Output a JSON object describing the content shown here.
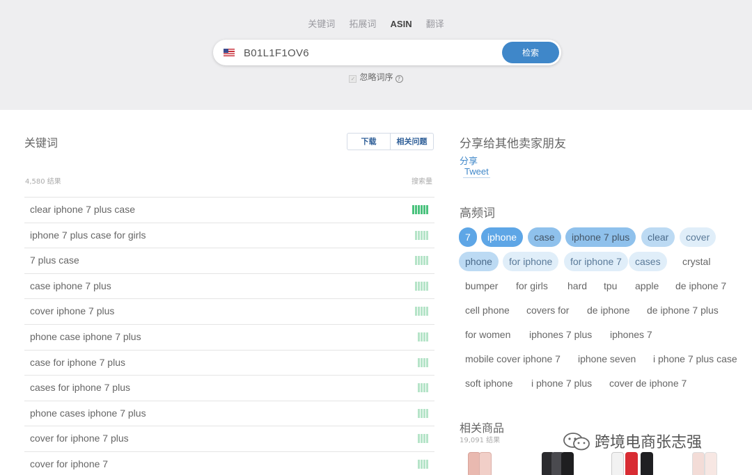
{
  "modes": [
    "关键词",
    "拓展词",
    "ASIN",
    "翻译"
  ],
  "active_mode_index": 2,
  "search": {
    "flag": "us-flag-icon",
    "value": "B01L1F1OV6",
    "button_label": "检索",
    "ignore_order_label": "忽略词序",
    "ignore_order_checked": true
  },
  "keywords_panel": {
    "title": "关键词",
    "download_label": "下载",
    "related_questions_label": "相关问题",
    "results_count": "4,580 结果",
    "volume_label": "搜索量",
    "rows": [
      {
        "keyword": "clear iphone 7 plus case",
        "bars": 6,
        "strong": true
      },
      {
        "keyword": "iphone 7 plus case for girls",
        "bars": 5,
        "strong": false
      },
      {
        "keyword": "7 plus case",
        "bars": 5,
        "strong": false
      },
      {
        "keyword": "case iphone 7 plus",
        "bars": 5,
        "strong": false
      },
      {
        "keyword": "cover iphone 7 plus",
        "bars": 5,
        "strong": false
      },
      {
        "keyword": "phone case iphone 7 plus",
        "bars": 4,
        "strong": false
      },
      {
        "keyword": "case for iphone 7 plus",
        "bars": 4,
        "strong": false
      },
      {
        "keyword": "cases for iphone 7 plus",
        "bars": 4,
        "strong": false
      },
      {
        "keyword": "phone cases iphone 7 plus",
        "bars": 4,
        "strong": false
      },
      {
        "keyword": "cover for iphone 7 plus",
        "bars": 4,
        "strong": false
      },
      {
        "keyword": "cover for iphone 7",
        "bars": 4,
        "strong": false
      }
    ]
  },
  "share": {
    "title": "分享给其他卖家朋友",
    "share_link": "分享",
    "tweet_label": "Tweet"
  },
  "high_frequency": {
    "title": "高频词",
    "tags": [
      {
        "text": "7",
        "level": 1
      },
      {
        "text": "iphone",
        "level": 1
      },
      {
        "text": "case",
        "level": 2
      },
      {
        "text": "iphone 7 plus",
        "level": 2
      },
      {
        "text": "clear",
        "level": 3
      },
      {
        "text": "cover",
        "level": 4
      },
      {
        "text": "phone",
        "level": 3
      },
      {
        "text": "for iphone",
        "level": 4
      },
      {
        "text": "for iphone 7",
        "level": 4
      },
      {
        "text": "cases",
        "level": 4
      },
      {
        "text": "crystal",
        "level": 5
      },
      {
        "text": "bumper",
        "level": 5
      },
      {
        "text": "for girls",
        "level": 5
      },
      {
        "text": "hard",
        "level": 5
      },
      {
        "text": "tpu",
        "level": 5
      },
      {
        "text": "apple",
        "level": 5
      },
      {
        "text": "de iphone 7",
        "level": 5
      },
      {
        "text": "cell phone",
        "level": 5
      },
      {
        "text": "covers for",
        "level": 5
      },
      {
        "text": "de iphone",
        "level": 5
      },
      {
        "text": "de iphone 7 plus",
        "level": 5
      },
      {
        "text": "for women",
        "level": 5
      },
      {
        "text": "iphones 7 plus",
        "level": 5
      },
      {
        "text": "iphones 7",
        "level": 5
      },
      {
        "text": "mobile cover iphone 7",
        "level": 5
      },
      {
        "text": "iphone seven",
        "level": 5
      },
      {
        "text": "i phone 7 plus case",
        "level": 5
      },
      {
        "text": "soft iphone",
        "level": 5
      },
      {
        "text": "i phone 7 plus",
        "level": 5
      },
      {
        "text": "cover de iphone 7",
        "level": 5
      }
    ]
  },
  "related_products": {
    "title": "相关商品",
    "count": "19,091 结果"
  },
  "watermark": {
    "text": "跨境电商张志强",
    "icon": "wechat-icon"
  },
  "colors": {
    "accent": "#3f87c9",
    "volume_strong": "#4ac27d",
    "volume_light": "#b5e4c8",
    "top_band": "#eeeef0"
  }
}
